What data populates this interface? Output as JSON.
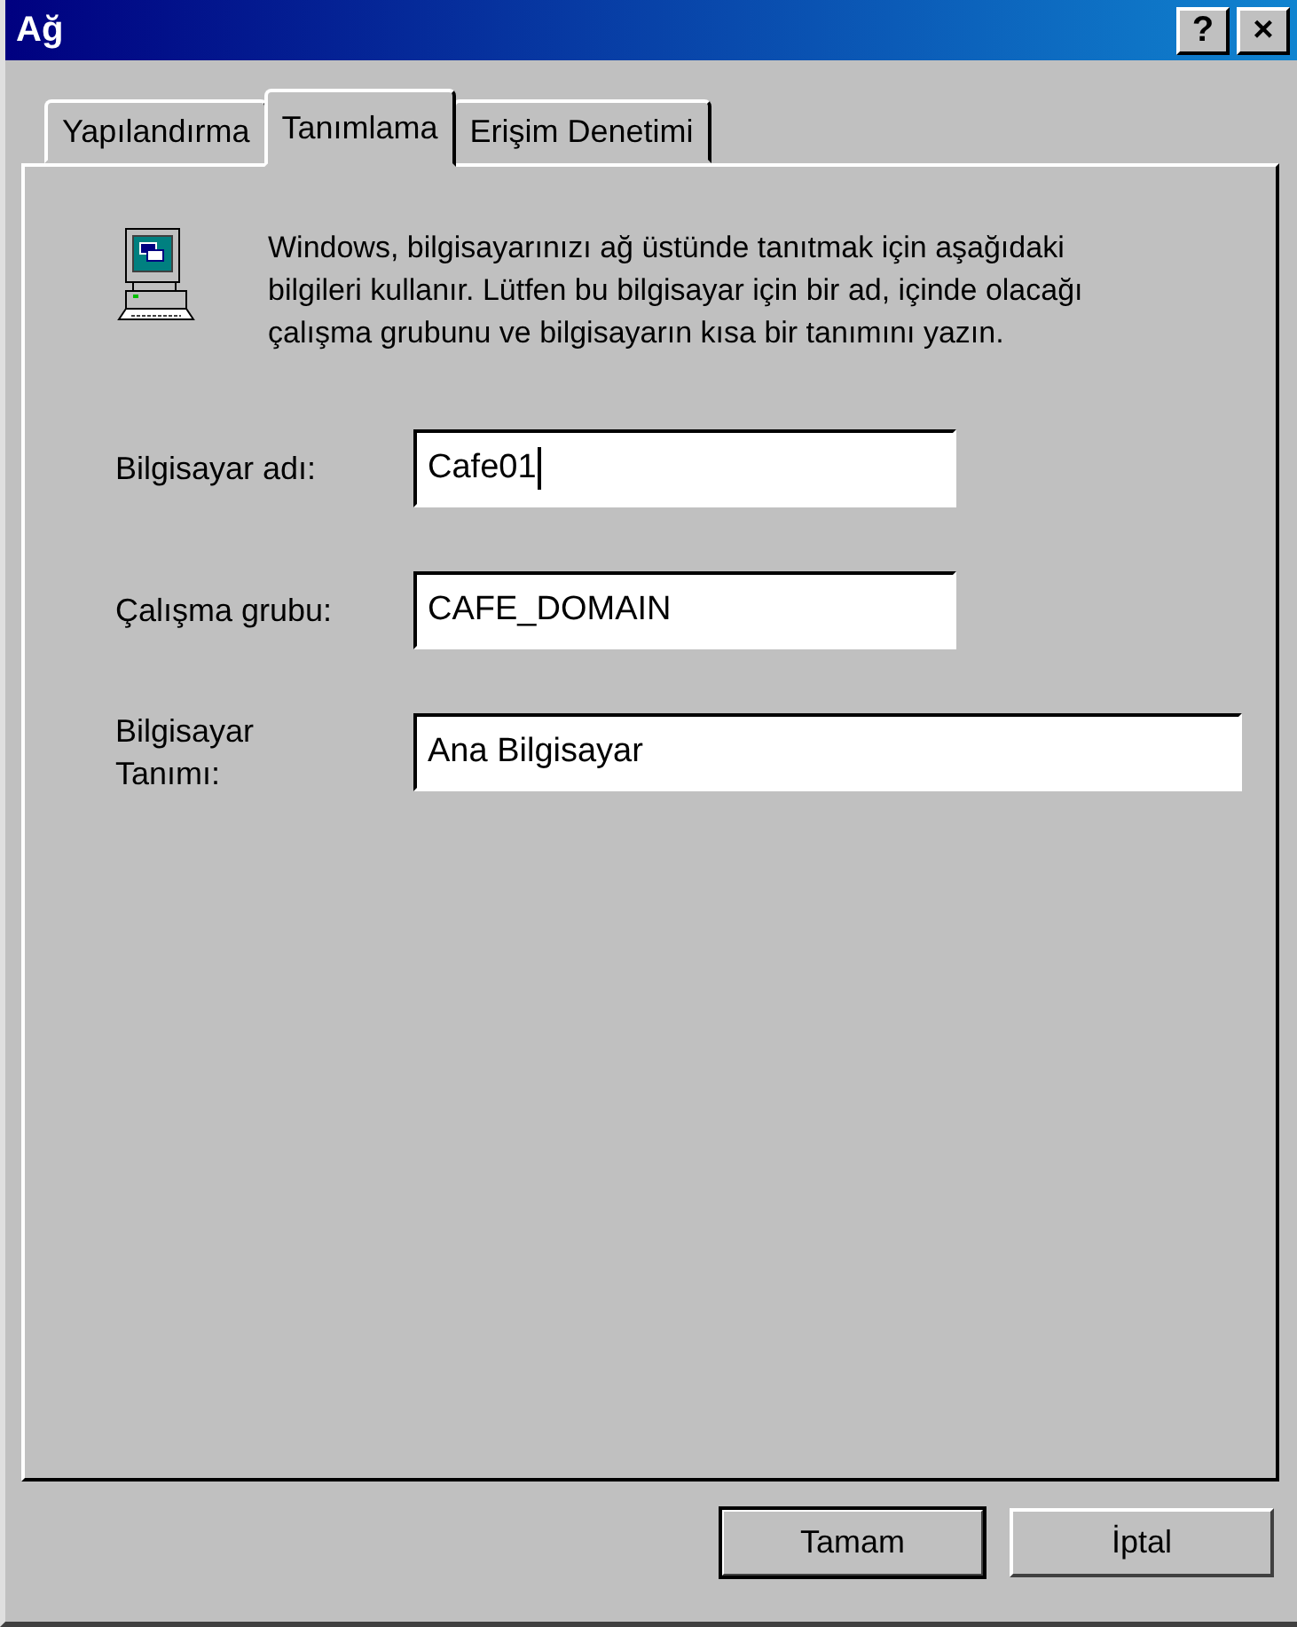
{
  "window": {
    "title": "Ağ",
    "buttons": [
      "?",
      "×"
    ]
  },
  "tabs": [
    {
      "label": "Yapılandırma",
      "selected": false
    },
    {
      "label": "Tanımlama",
      "selected": true
    },
    {
      "label": "Erişim Denetimi",
      "selected": false
    }
  ],
  "intro": "Windows, bilgisayarınızı ağ üstünde tanıtmak için aşağıdaki bilgileri kullanır. Lütfen bu bilgisayar için bir ad, içinde olacağı çalışma grubunu ve bilgisayarın kısa bir tanımını yazın.",
  "fields": [
    {
      "label": "Bilgisayar adı:",
      "value": "Cafe01",
      "focused": true
    },
    {
      "label": "Çalışma grubu:",
      "value": "CAFE_DOMAIN",
      "focused": false
    },
    {
      "label": "Bilgisayar Tanımı:",
      "value": "Ana Bilgisayar",
      "focused": false
    }
  ],
  "buttons": [
    {
      "label": "Tamam",
      "default": true
    },
    {
      "label": "İptal",
      "default": false
    }
  ]
}
